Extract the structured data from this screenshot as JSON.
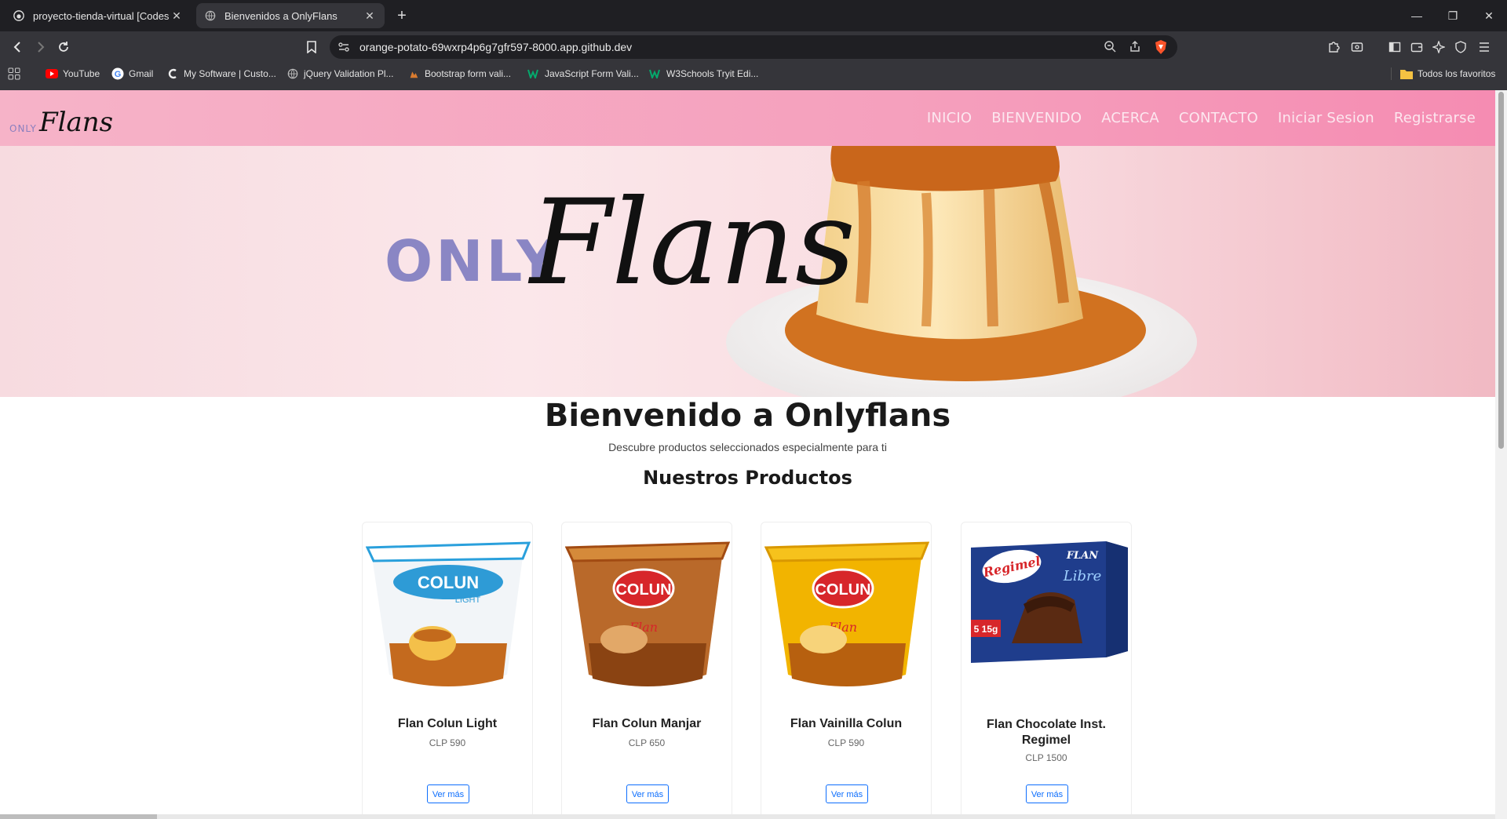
{
  "browser": {
    "tabs": [
      {
        "title": "proyecto-tienda-virtual [Codespa",
        "icon": "github-icon",
        "active": false
      },
      {
        "title": "Bienvenidos a OnlyFlans",
        "icon": "globe-icon",
        "active": true
      }
    ],
    "url": "orange-potato-69wxrp4p6g7gfr597-8000.app.github.dev",
    "bookmarks": [
      {
        "label": "YouTube",
        "icon": "youtube-icon"
      },
      {
        "label": "Gmail",
        "icon": "google-icon"
      },
      {
        "label": "My Software | Custo...",
        "icon": "c-icon"
      },
      {
        "label": "jQuery Validation Pl...",
        "icon": "globe-icon"
      },
      {
        "label": "Bootstrap form vali...",
        "icon": "bootstrap-icon"
      },
      {
        "label": "JavaScript Form Vali...",
        "icon": "w3schools-icon"
      },
      {
        "label": "W3Schools Tryit Edi...",
        "icon": "w3schools-icon"
      }
    ],
    "all_bookmarks": "Todos los favoritos"
  },
  "site": {
    "logo": {
      "small": "ONLY",
      "script": "Flans"
    },
    "nav": [
      "INICIO",
      "BIENVENIDO",
      "ACERCA",
      "CONTACTO",
      "Iniciar Sesion",
      "Registrarse"
    ],
    "hero": {
      "small": "ONLY",
      "script": "Flans"
    },
    "welcome_title": "Bienvenido a Onlyflans",
    "welcome_subtitle": "Descubre productos seleccionados especialmente para ti",
    "products_title": "Nuestros Productos",
    "products": [
      {
        "name": "Flan Colun Light",
        "price": "CLP 590",
        "button": "Ver más",
        "image": "colun-light-cup"
      },
      {
        "name": "Flan Colun Manjar",
        "price": "CLP 650",
        "button": "Ver más",
        "image": "colun-manjar-cup"
      },
      {
        "name": "Flan Vainilla Colun",
        "price": "CLP 590",
        "button": "Ver más",
        "image": "colun-vainilla-cup"
      },
      {
        "name": "Flan Chocolate Inst. Regimel",
        "price": "CLP 1500",
        "button": "Ver más",
        "image": "regimel-box"
      }
    ],
    "product_image_text": {
      "colun": "COLUN",
      "light": "LIGHT",
      "flan": "Flan",
      "regimel": "Regimel",
      "box_flan": "FLAN",
      "box_libre": "Libre",
      "box_qty": "5 15g"
    }
  },
  "colors": {
    "nav_pink": "#f5a0bd",
    "button_blue": "#0d6efd",
    "caramel": "#d9791f"
  }
}
